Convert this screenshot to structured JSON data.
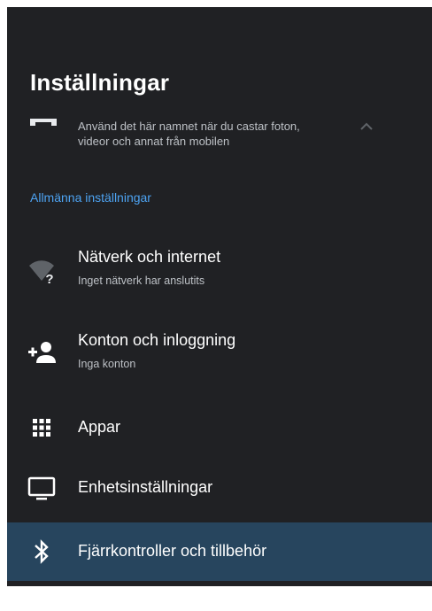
{
  "header": {
    "title": "Inställningar"
  },
  "cast": {
    "line1": "Använd det här namnet när du castar foton,",
    "line2": "videor och annat från mobilen",
    "icon": "cast-device-icon"
  },
  "section": {
    "label": "Allmänna inställningar",
    "color": "#4da3f2"
  },
  "items": [
    {
      "title": "Nätverk och internet",
      "subtitle": "Inget nätverk har anslutits",
      "icon": "wifi-question-icon"
    },
    {
      "title": "Konton och inloggning",
      "subtitle": "Inga konton",
      "icon": "add-person-icon"
    },
    {
      "title": "Appar",
      "icon": "apps-grid-icon"
    },
    {
      "title": "Enhetsinställningar",
      "icon": "tv-icon"
    },
    {
      "title": "Fjärrkontroller och tillbehör",
      "icon": "bluetooth-icon",
      "selected": true
    }
  ],
  "colors": {
    "background": "#202124",
    "selected_row": "#27455e",
    "accent": "#4da3f2"
  }
}
